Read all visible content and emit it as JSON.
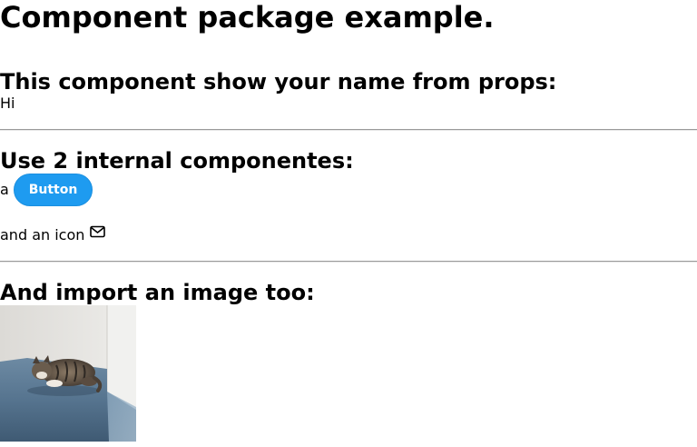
{
  "header": {
    "title": "Component package example."
  },
  "name_section": {
    "heading": "This component show your name from props:",
    "greeting": "Hi"
  },
  "components_section": {
    "heading": "Use 2 internal componentes:",
    "prefix": "a",
    "button_label": "Button",
    "icon_text": "and an icon",
    "icon": "mail-icon",
    "button_color": "#1e9bf0"
  },
  "image_section": {
    "heading": "And import an image too:",
    "image_subject": "cat-sleeping-on-bed"
  }
}
